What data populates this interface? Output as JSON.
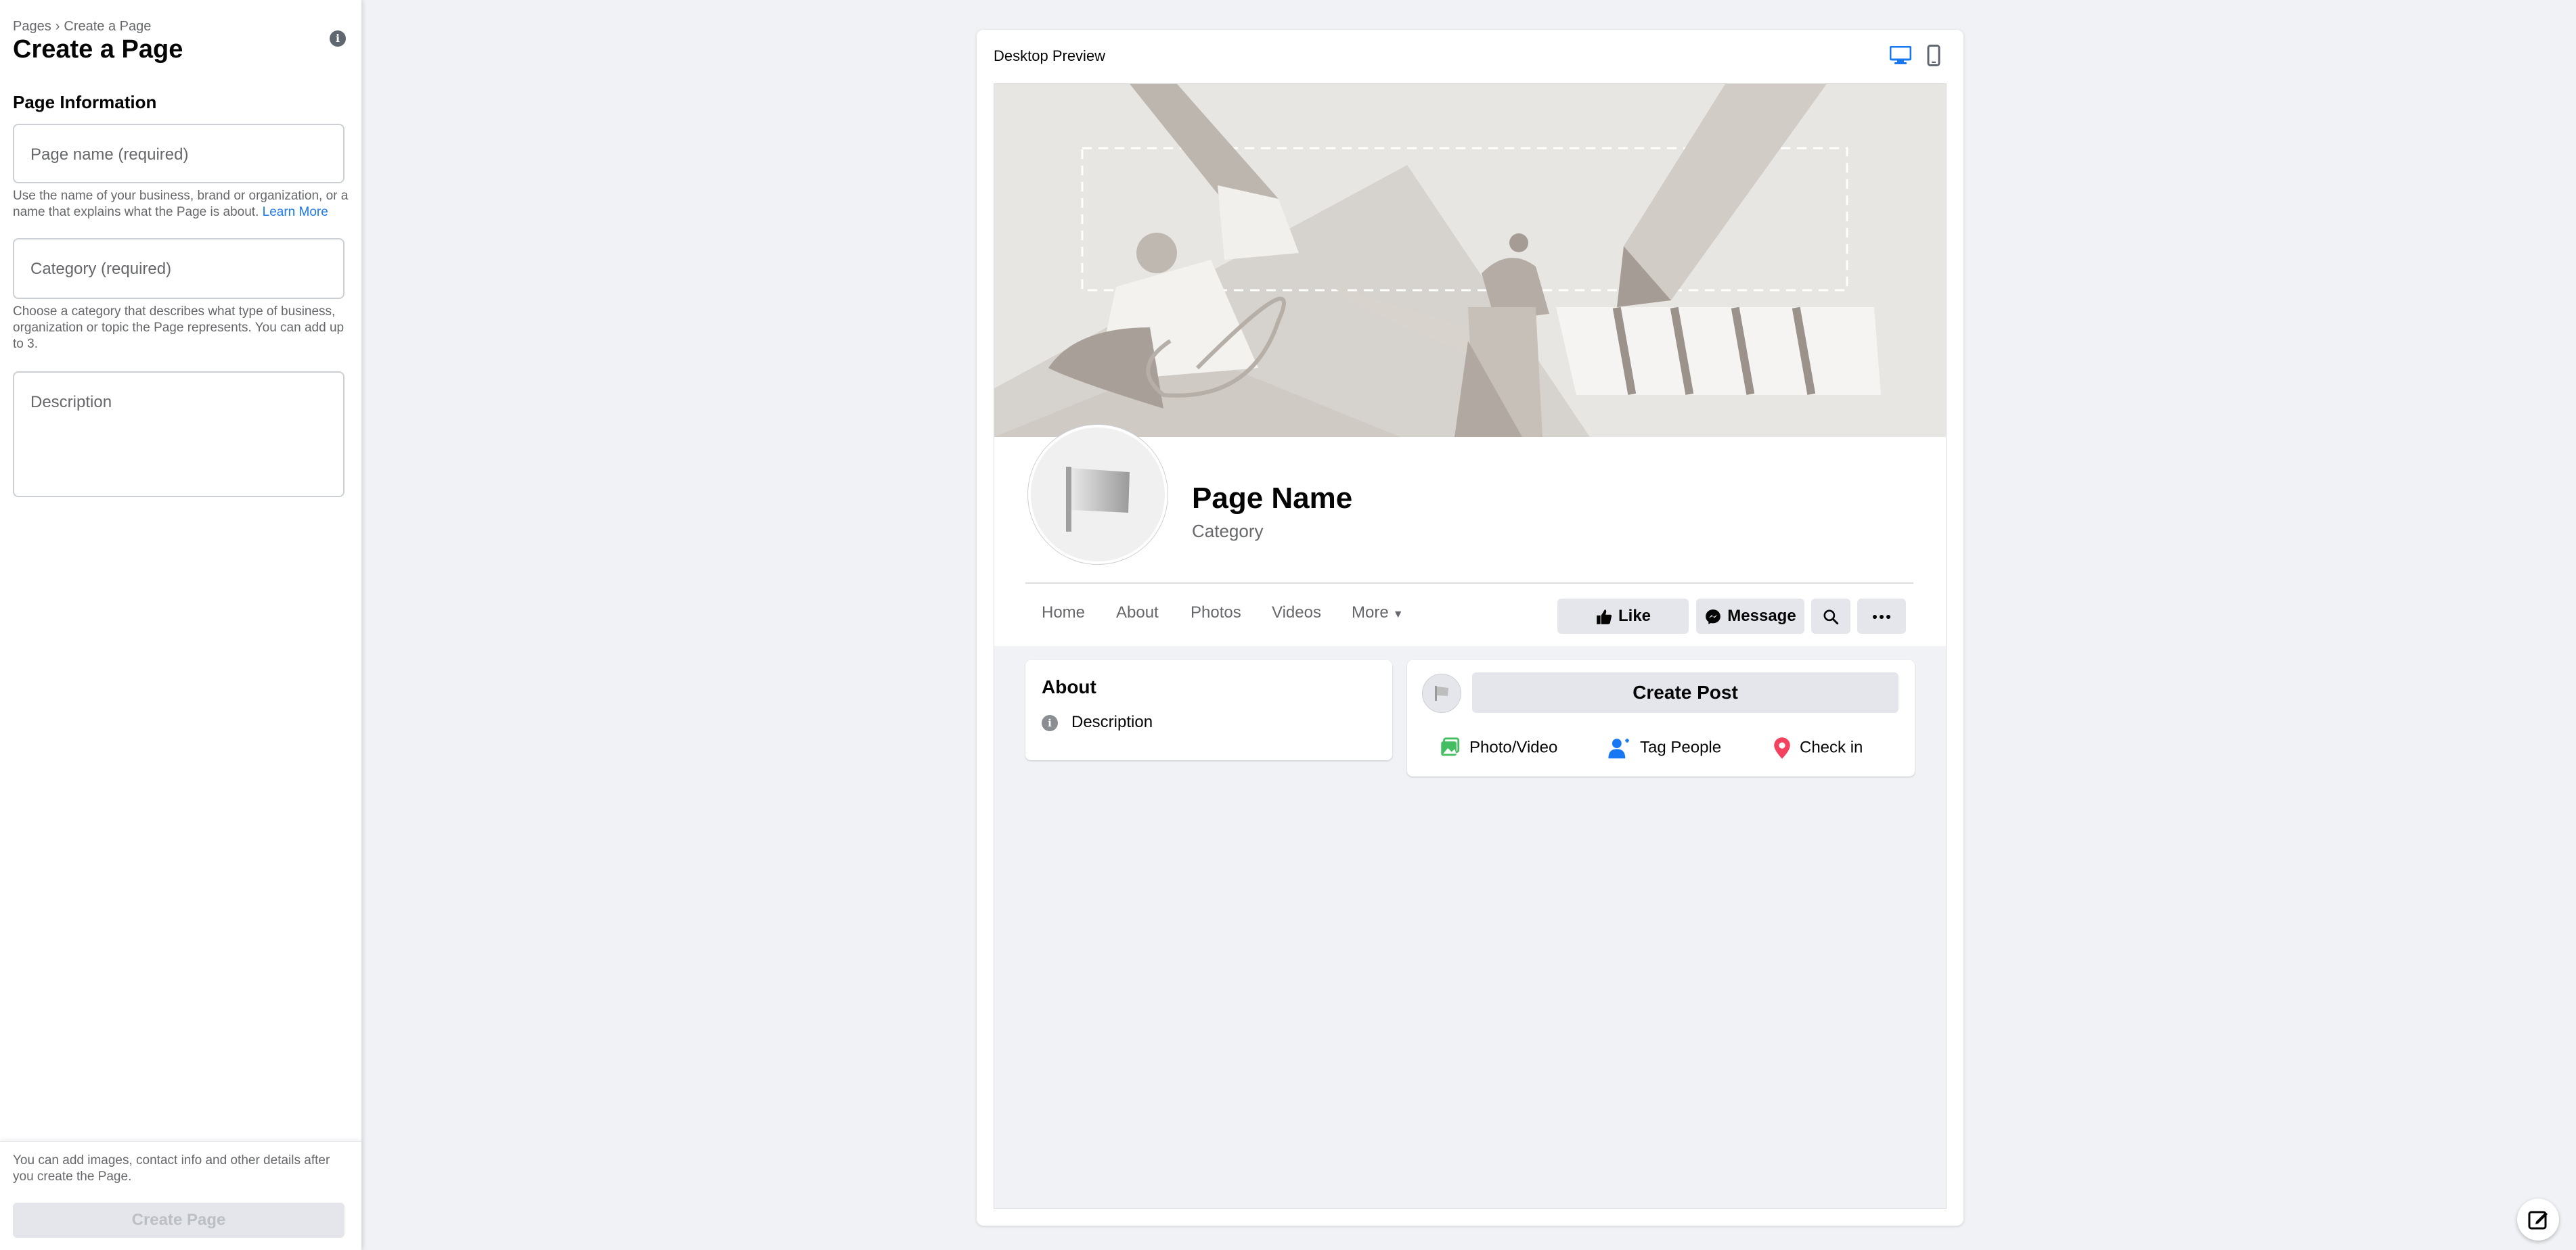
{
  "sidebar": {
    "breadcrumb": {
      "parent": "Pages",
      "separator": "›",
      "current": "Create a Page"
    },
    "title": "Create a Page",
    "section_title": "Page Information",
    "page_name": {
      "placeholder": "Page name (required)",
      "value": ""
    },
    "page_name_help": "Use the name of your business, brand or organization, or a name that explains what the Page is about.",
    "learn_more": "Learn More",
    "category": {
      "placeholder": "Category (required)",
      "value": ""
    },
    "category_help": "Choose a category that describes what type of business, organization or topic the Page represents. You can add up to 3.",
    "description": {
      "placeholder": "Description",
      "value": ""
    },
    "bottom_note": "You can add images, contact info and other details after you create the Page.",
    "create_button": "Create Page"
  },
  "preview": {
    "title": "Desktop Preview",
    "active_view": "desktop",
    "page_name": "Page Name",
    "category": "Category",
    "tabs": [
      "Home",
      "About",
      "Photos",
      "Videos",
      "More"
    ],
    "buttons": {
      "like": "Like",
      "message": "Message"
    },
    "about": {
      "heading": "About",
      "description": "Description"
    },
    "post": {
      "create": "Create Post",
      "actions": [
        "Photo/Video",
        "Tag People",
        "Check in"
      ]
    }
  },
  "colors": {
    "accent": "#1877f2",
    "page_bg": "#f0f2f5",
    "button_bg": "#e4e6eb",
    "photo_green": "#45bd62",
    "checkin_red": "#f3425f"
  }
}
